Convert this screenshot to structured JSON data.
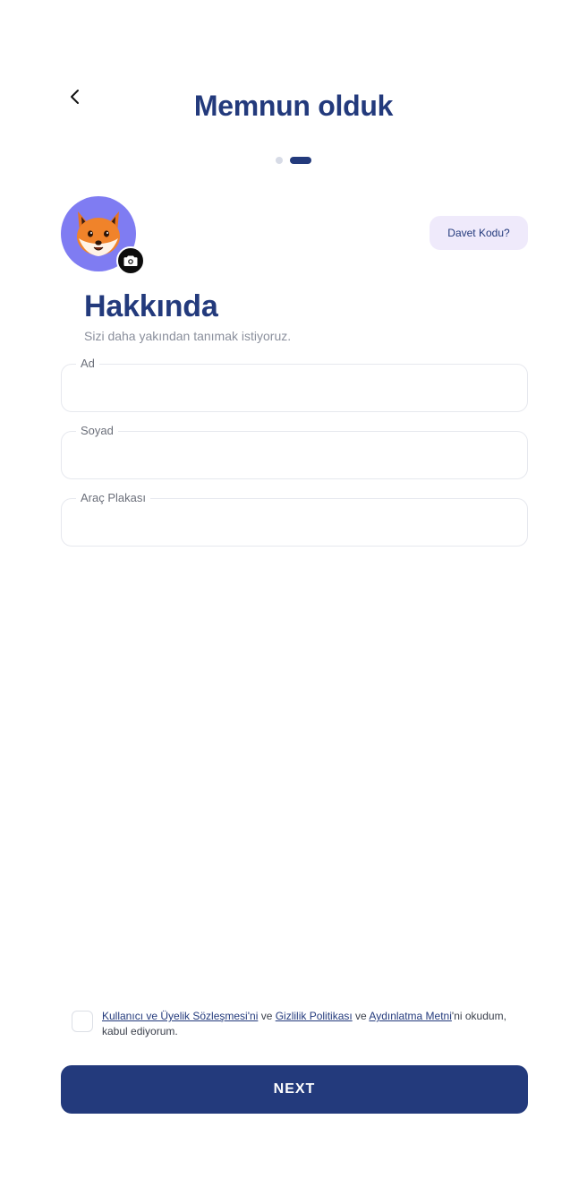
{
  "header": {
    "title": "Memnun olduk",
    "back_icon": "chevron-left-icon"
  },
  "pager": {
    "total_steps": 2,
    "current_step": 2
  },
  "profile": {
    "avatar_icon": "fox-avatar-icon",
    "camera_icon": "camera-icon",
    "avatar_bg": "#7f7cf2"
  },
  "invite": {
    "label": "Davet Kodu?"
  },
  "about": {
    "title": "Hakkında",
    "subtitle": "Sizi daha yakından tanımak istiyoruz."
  },
  "fields": {
    "first_name": {
      "label": "Ad",
      "value": ""
    },
    "last_name": {
      "label": "Soyad",
      "value": ""
    },
    "plate": {
      "label": "Araç Plakası",
      "value": ""
    }
  },
  "terms": {
    "checked": false,
    "link_membership": "Kullanıcı ve Üyelik Sözleşmesi'ni",
    "conj1": " ve ",
    "link_privacy": "Gizlilik Politikası",
    "conj2": " ve ",
    "link_clarification": "Aydınlatma Metni",
    "suffix": "'ni okudum, kabul ediyorum."
  },
  "footer": {
    "next_label": "NEXT"
  },
  "colors": {
    "primary": "#233a7c",
    "invite_bg": "#efeafb",
    "border": "#e6e8ee"
  }
}
